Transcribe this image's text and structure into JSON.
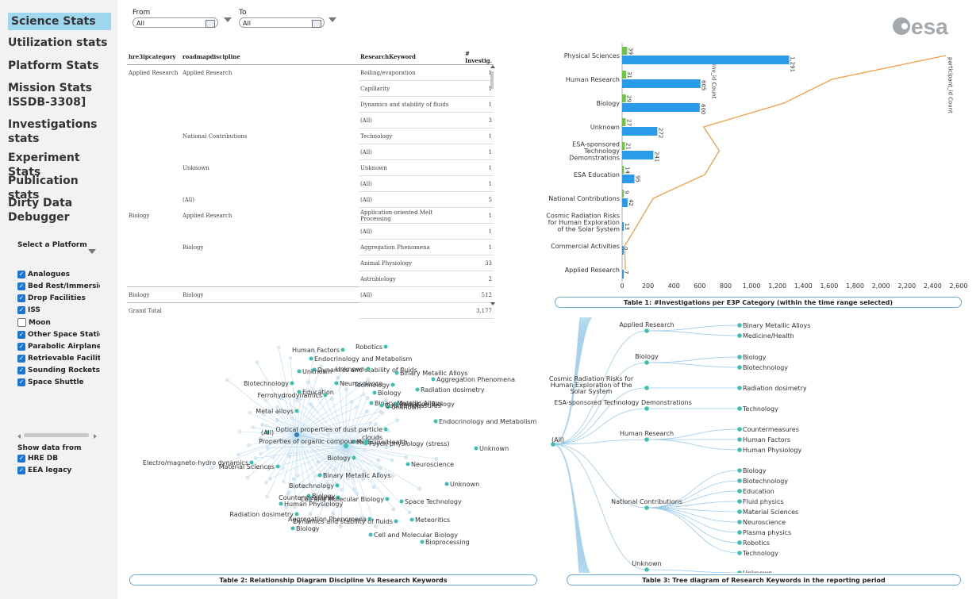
{
  "sidebar": {
    "nav": [
      {
        "label": "Science Stats",
        "active": true
      },
      {
        "label": "Utilization stats"
      },
      {
        "label": "Platform Stats"
      },
      {
        "label": "Mission Stats ISSDB-3308]"
      },
      {
        "label": "Investigations stats"
      },
      {
        "label": "Experiment Stats"
      },
      {
        "label": "Publication stats"
      },
      {
        "label": "Dirty Data Debugger"
      }
    ],
    "platform_title": "Select a Platform",
    "platforms": [
      {
        "label": "Analogues",
        "checked": true
      },
      {
        "label": "Bed Rest/Immersion",
        "checked": true
      },
      {
        "label": "Drop Facilities",
        "checked": true
      },
      {
        "label": "ISS",
        "checked": true
      },
      {
        "label": "Moon",
        "checked": false
      },
      {
        "label": "Other Space Stations",
        "checked": true
      },
      {
        "label": "Parabolic Airplanes",
        "checked": true
      },
      {
        "label": "Retrievable Facilities",
        "checked": true
      },
      {
        "label": "Sounding Rockets",
        "checked": true
      },
      {
        "label": "Space Shuttle",
        "checked": true
      }
    ],
    "source_title": "Show data from",
    "sources": [
      {
        "label": "HRE DB",
        "checked": true
      },
      {
        "label": "EEA legacy",
        "checked": true
      }
    ]
  },
  "filters": {
    "from_label": "From",
    "from_value": "All",
    "to_label": "To",
    "to_value": "All"
  },
  "logo": "esa",
  "table": {
    "headers": [
      "hre3ipcategory",
      "roadmapdiscipline",
      "ResearchKeyword",
      "# Investig."
    ],
    "rows": [
      [
        "Applied Research",
        "Applied Research",
        "Boiling/evaporation",
        "1"
      ],
      [
        "",
        "",
        "Capillarity",
        "1"
      ],
      [
        "",
        "",
        "Dynamics and stability of fluids",
        "1"
      ],
      [
        "",
        "",
        "(All)",
        "3"
      ],
      [
        "",
        "National Contributions",
        "Technology",
        "1"
      ],
      [
        "",
        "",
        "(All)",
        "1"
      ],
      [
        "",
        "Unknown",
        "Unknown",
        "1"
      ],
      [
        "",
        "",
        "(All)",
        "1"
      ],
      [
        "",
        "(All)",
        "(All)",
        "5"
      ],
      [
        "Biology",
        "Applied Research",
        "Application-oriented Melt Processing",
        "1"
      ],
      [
        "",
        "",
        "(All)",
        "1"
      ],
      [
        "",
        "Biology",
        "Aggregation Phenomena",
        "1"
      ],
      [
        "",
        "",
        "Animal Physiology",
        "33"
      ],
      [
        "",
        "",
        "Astrobiology",
        "2"
      ],
      [
        "Biology",
        "Biology",
        "(All)",
        "512"
      ],
      [
        "Grand Total",
        "",
        "",
        "3,177"
      ]
    ]
  },
  "chart_data": {
    "type": "bar",
    "title": "Table 1: #Investigations per E3P Category (within the time range selected)",
    "categories": [
      "Physical Sciences",
      "Human Research",
      "Biology",
      "Unknown",
      "ESA-sponsored Technology Demonstrations",
      "ESA Education",
      "National Contributions",
      "Cosmic Radiation Risks for Human Exploration of the Solar System",
      "Commercial Activities",
      "Applied Research"
    ],
    "series": [
      {
        "name": "inv_id Count",
        "color": "#2a9be8",
        "values": [
          1291,
          605,
          600,
          272,
          241,
          95,
          42,
          13,
          0,
          7
        ]
      },
      {
        "name": "participant_id Count",
        "color": "#6cc644",
        "values": [
          39,
          31,
          29,
          27,
          21,
          14,
          9,
          0,
          0,
          0
        ]
      }
    ],
    "line": {
      "name": "participant_id Count",
      "color": "#f0a04b",
      "values": [
        2500,
        1620,
        1250,
        630,
        750,
        640,
        240,
        130,
        20,
        25
      ]
    },
    "x_ticks": [
      "0",
      "200",
      "400",
      "600",
      "800",
      "1,000",
      "1,200",
      "1,400",
      "1,600",
      "1,800",
      "2,000",
      "2,200",
      "2,400",
      "2,600"
    ],
    "xlim": [
      0,
      2600
    ],
    "grid": false
  },
  "network": {
    "caption": "Table 2: Relationship Diagram Discipline Vs Research Keywords",
    "labels": [
      "Human Factors",
      "Endocrinology and Metabolism",
      "Robotics",
      "Dynamics and stability of fluids",
      "Unknown",
      "Unknown",
      "Aggregation Phenomena",
      "Binary Metallic Alloys",
      "Biotechnology",
      "Neuroscience",
      "Technology",
      "Education",
      "Radiation dosimetry",
      "Ferrohydrodynamics",
      "Biology",
      "Radiation Biology",
      "Unknown",
      "Binary Metallic Alloys",
      "Metal alloys",
      "Countermeasures",
      "Endocrinology and Metabolism",
      "Optical properties of dust particle clouds",
      "(All)",
      "Medicine/Health",
      "Properties of organic compounds",
      "Unknown",
      "Psych-physiology (stress)",
      "Electro/magneto-hydro dynamics",
      "Neuroscience",
      "Material Sciences",
      "Biology",
      "Binary Metallic Alloys",
      "Biotechnology",
      "Unknown",
      "Biology",
      "Countermeasures",
      "Human Physiology",
      "Cell and Molecular Biology",
      "Space Technology",
      "Radiation dosimetry",
      "Meteoritics",
      "Aggregation Phenomena",
      "Biology",
      "Dynamics and stability of fluids",
      "Cell and Molecular Biology",
      "Bioprocessing"
    ]
  },
  "tree": {
    "caption": "Table 3: Tree diagram of Research Keywords in the reporting period",
    "root": "(All)",
    "mid": [
      "Applied Research",
      "Biology",
      "Cosmic Radiation Risks for Human Exploration of the Solar System",
      "ESA-sponsored Technology Demonstrations",
      "Human Research",
      "National Contributions",
      "Unknown"
    ],
    "leaves": [
      {
        "label": "Binary Metallic Alloys",
        "parent": 0
      },
      {
        "label": "Medicine/Health",
        "parent": 0
      },
      {
        "label": "Biology",
        "parent": 1
      },
      {
        "label": "Biotechnology",
        "parent": 1
      },
      {
        "label": "Radiation dosimetry",
        "parent": 2
      },
      {
        "label": "Technology",
        "parent": 3
      },
      {
        "label": "Countermeasures",
        "parent": 4
      },
      {
        "label": "Human Factors",
        "parent": 4
      },
      {
        "label": "Human Physiology",
        "parent": 4
      },
      {
        "label": "Biology",
        "parent": 5
      },
      {
        "label": "Biotechnology",
        "parent": 5
      },
      {
        "label": "Education",
        "parent": 5
      },
      {
        "label": "Fluid physics",
        "parent": 5
      },
      {
        "label": "Material Sciences",
        "parent": 5
      },
      {
        "label": "Neuroscience",
        "parent": 5
      },
      {
        "label": "Plasma physics",
        "parent": 5
      },
      {
        "label": "Robotics",
        "parent": 5
      },
      {
        "label": "Technology",
        "parent": 5
      },
      {
        "label": "Unknown",
        "parent": 6
      }
    ]
  }
}
